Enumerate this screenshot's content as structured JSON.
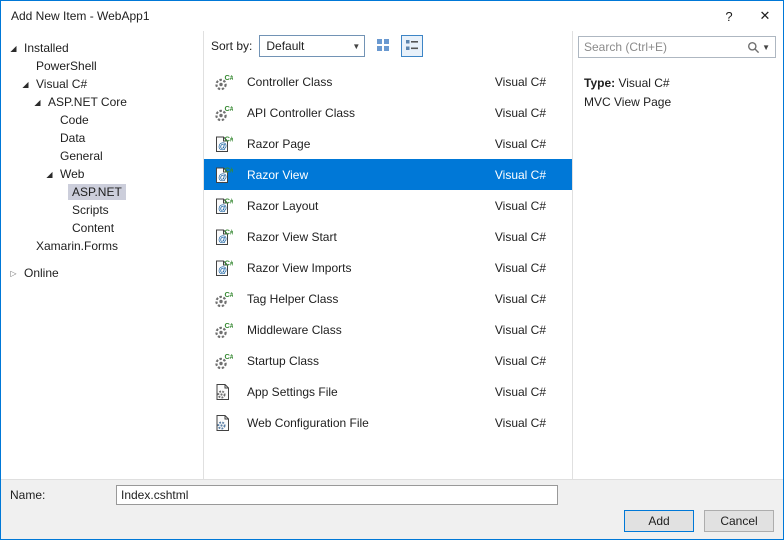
{
  "window": {
    "title": "Add New Item - WebApp1",
    "help": "?",
    "close": "✕"
  },
  "tree": {
    "items": [
      {
        "label": "Installed",
        "level": 0,
        "state": "expanded",
        "selected": false
      },
      {
        "label": "PowerShell",
        "level": 1,
        "state": "leaf",
        "selected": false
      },
      {
        "label": "Visual C#",
        "level": 1,
        "state": "expanded",
        "selected": false
      },
      {
        "label": "ASP.NET Core",
        "level": 2,
        "state": "expanded",
        "selected": false
      },
      {
        "label": "Code",
        "level": 3,
        "state": "leaf",
        "selected": false
      },
      {
        "label": "Data",
        "level": 3,
        "state": "leaf",
        "selected": false
      },
      {
        "label": "General",
        "level": 3,
        "state": "leaf",
        "selected": false
      },
      {
        "label": "Web",
        "level": 3,
        "state": "expanded",
        "selected": false
      },
      {
        "label": "ASP.NET",
        "level": 4,
        "state": "leaf",
        "selected": true
      },
      {
        "label": "Scripts",
        "level": 4,
        "state": "leaf",
        "selected": false
      },
      {
        "label": "Content",
        "level": 4,
        "state": "leaf",
        "selected": false
      },
      {
        "label": "Xamarin.Forms",
        "level": 1,
        "state": "leaf",
        "selected": false
      },
      {
        "label": "Online",
        "level": 0,
        "state": "collapsed",
        "selected": false
      }
    ]
  },
  "sortbar": {
    "label": "Sort by:",
    "value": "Default"
  },
  "list": {
    "items": [
      {
        "label": "Controller Class",
        "lang": "Visual C#",
        "icon": "csharp-class",
        "selected": false
      },
      {
        "label": "API Controller Class",
        "lang": "Visual C#",
        "icon": "csharp-class",
        "selected": false
      },
      {
        "label": "Razor Page",
        "lang": "Visual C#",
        "icon": "razor",
        "selected": false
      },
      {
        "label": "Razor View",
        "lang": "Visual C#",
        "icon": "razor",
        "selected": true
      },
      {
        "label": "Razor Layout",
        "lang": "Visual C#",
        "icon": "razor",
        "selected": false
      },
      {
        "label": "Razor View Start",
        "lang": "Visual C#",
        "icon": "razor",
        "selected": false
      },
      {
        "label": "Razor View Imports",
        "lang": "Visual C#",
        "icon": "razor",
        "selected": false
      },
      {
        "label": "Tag Helper Class",
        "lang": "Visual C#",
        "icon": "csharp-class",
        "selected": false
      },
      {
        "label": "Middleware Class",
        "lang": "Visual C#",
        "icon": "csharp-class",
        "selected": false
      },
      {
        "label": "Startup Class",
        "lang": "Visual C#",
        "icon": "csharp-class",
        "selected": false
      },
      {
        "label": "App Settings File",
        "lang": "Visual C#",
        "icon": "app-settings",
        "selected": false
      },
      {
        "label": "Web Configuration File",
        "lang": "Visual C#",
        "icon": "web-config",
        "selected": false
      }
    ]
  },
  "search": {
    "placeholder": "Search (Ctrl+E)"
  },
  "details": {
    "type_label": "Type:",
    "type_value": "Visual C#",
    "description": "MVC View Page"
  },
  "footer": {
    "name_label": "Name:",
    "name_value": "Index.cshtml",
    "add": "Add",
    "cancel": "Cancel"
  },
  "colors": {
    "selection": "#0078d7",
    "tree_selection": "#cccedb",
    "accent": "#0078d7"
  }
}
